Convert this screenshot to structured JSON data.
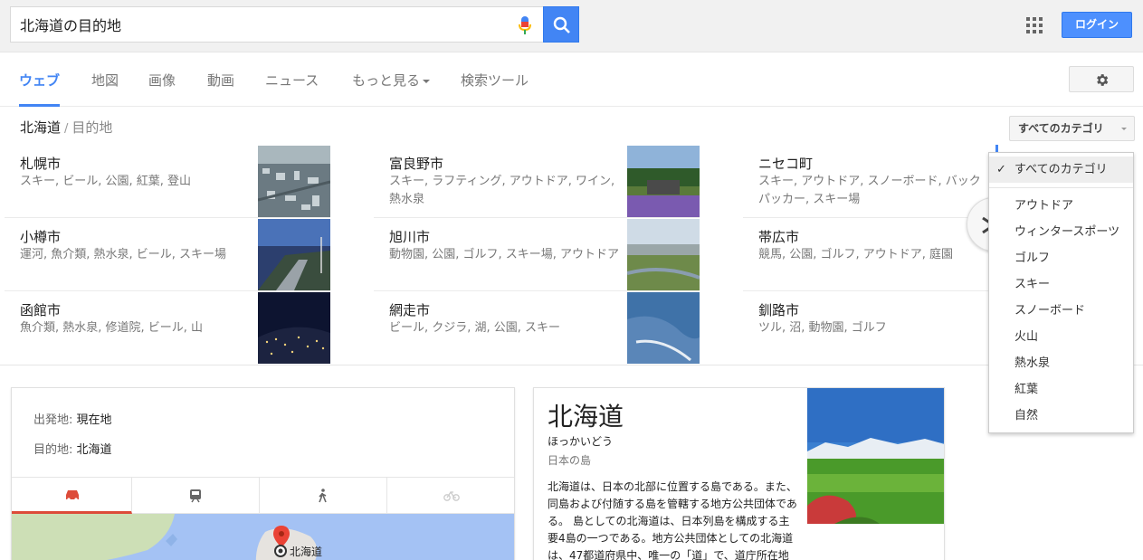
{
  "search": {
    "query": "北海道の目的地",
    "placeholder": ""
  },
  "header": {
    "login_label": "ログイン"
  },
  "tabs": [
    {
      "label": "ウェブ",
      "active": true
    },
    {
      "label": "地図"
    },
    {
      "label": "画像"
    },
    {
      "label": "動画"
    },
    {
      "label": "ニュース"
    },
    {
      "label": "もっと見る"
    },
    {
      "label": "検索ツール"
    }
  ],
  "breadcrumb": {
    "root": "北海道",
    "separator": "/",
    "current": "目的地"
  },
  "category_select": {
    "selected": "すべてのカテゴリ"
  },
  "places": [
    {
      "name": "札幌市",
      "tags": "スキー, ビール, 公園, 紅葉, 登山"
    },
    {
      "name": "小樽市",
      "tags": "運河, 魚介類, 熱水泉, ビール, スキー場"
    },
    {
      "name": "函館市",
      "tags": "魚介類, 熱水泉, 修道院, ビール, 山"
    },
    {
      "name": "富良野市",
      "tags": "スキー, ラフティング, アウトドア, ワイン, 熱水泉"
    },
    {
      "name": "旭川市",
      "tags": "動物園, 公園, ゴルフ, スキー場, アウトドア"
    },
    {
      "name": "網走市",
      "tags": "ビール, クジラ, 湖, 公園, スキー"
    },
    {
      "name": "ニセコ町",
      "tags": "スキー, アウトドア, スノーボード, バックパッカー, スキー場"
    },
    {
      "name": "帯広市",
      "tags": "競馬, 公園, ゴルフ, アウトドア, 庭園"
    },
    {
      "name": "釧路市",
      "tags": "ツル, 沼, 動物園, ゴルフ"
    }
  ],
  "category_menu": {
    "items": [
      {
        "label": "すべてのカテゴリ",
        "selected": true
      },
      {
        "label": "アウトドア"
      },
      {
        "label": "ウィンタースポーツ"
      },
      {
        "label": "ゴルフ"
      },
      {
        "label": "スキー"
      },
      {
        "label": "スノーボード"
      },
      {
        "label": "火山"
      },
      {
        "label": "熱水泉"
      },
      {
        "label": "紅葉"
      },
      {
        "label": "自然"
      }
    ]
  },
  "directions": {
    "origin_label": "出発地:",
    "origin_value": "現在地",
    "destination_label": "目的地:",
    "destination_value": "北海道",
    "modes": [
      "car-icon",
      "train-icon",
      "walk-icon",
      "bike-icon"
    ],
    "map_label": "北海道"
  },
  "knowledge": {
    "title": "北海道",
    "reading": "ほっかいどう",
    "type": "日本の島",
    "description": "北海道は、日本の北部に位置する島である。また、同島および付随する島を管轄する地方公共団体である。 島としての北海道は、日本列島を構成する主要4島の一つである。地方公共団体としての北海道は、47都道府県中、唯一の「道」で、道庁所在地は札幌市である。 北海道"
  },
  "colors": {
    "accent": "#4285f4",
    "mode_active": "#dd4b39",
    "map": "#a4c2f4"
  }
}
